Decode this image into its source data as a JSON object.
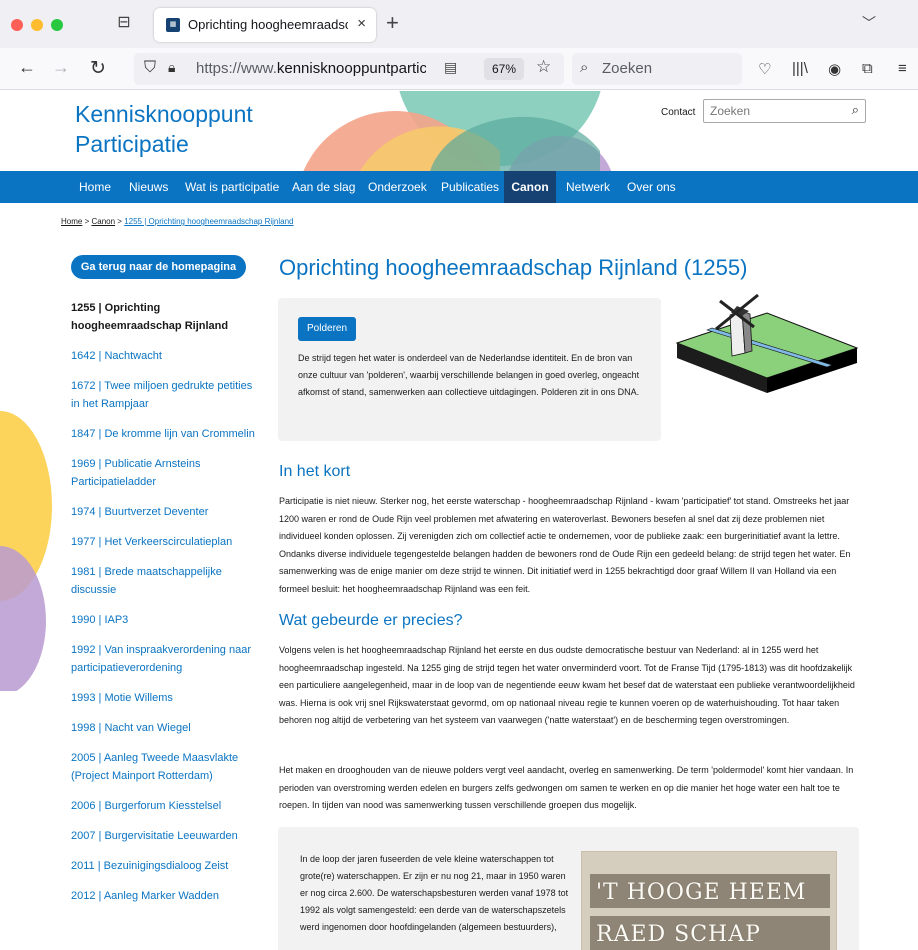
{
  "browser": {
    "tab_title": "Oprichting hoogheemraadschap",
    "tab_close": "×",
    "new_tab": "+",
    "url_prefix": "https://www.",
    "url_domain": "kennisknooppuntparticipati",
    "zoom": "67%",
    "search_placeholder": "Zoeken",
    "icons": [
      "tab-overview-icon",
      "back-arrow-icon",
      "forward-arrow-icon",
      "reload-icon",
      "shield-icon",
      "lock-icon",
      "reader-view-icon",
      "star-icon",
      "search-icon",
      "pocket-icon",
      "library-icon",
      "account-icon",
      "extensions-icon",
      "menu-icon"
    ]
  },
  "site": {
    "name_line1": "Kennisknooppunt",
    "name_line2": "Participatie",
    "contact": "Contact",
    "search_placeholder": "Zoeken",
    "colors": {
      "brand_blue": "#0b74c2",
      "nav_active": "#154273",
      "box_grey": "#f2f2f2"
    }
  },
  "nav": [
    {
      "label": "Home"
    },
    {
      "label": "Nieuws"
    },
    {
      "label": "Wat is participatie"
    },
    {
      "label": "Aan de slag"
    },
    {
      "label": "Onderzoek"
    },
    {
      "label": "Publicaties"
    },
    {
      "label": "Canon",
      "active": true
    },
    {
      "label": "Netwerk"
    },
    {
      "label": "Over ons"
    }
  ],
  "breadcrumb": {
    "home": "Home",
    "sep": ">",
    "canon": "Canon",
    "current": "1255 | Oprichting hoogheemraadschap Rijnland"
  },
  "sidebar": {
    "back_button": "Ga terug naar de homepagina",
    "items": [
      {
        "label": "1255 | Oprichting hoogheemraadschap Rijnland",
        "current": true
      },
      {
        "label": "1642 | Nachtwacht"
      },
      {
        "label": "1672 | Twee miljoen gedrukte petities in het Rampjaar"
      },
      {
        "label": "1847 | De kromme lijn van Crommelin"
      },
      {
        "label": "1969 | Publicatie Arnsteins Participatieladder"
      },
      {
        "label": "1974 | Buurtverzet Deventer"
      },
      {
        "label": "1977 | Het Verkeerscirculatieplan"
      },
      {
        "label": "1981 | Brede maatschappelijke discussie"
      },
      {
        "label": "1990 | IAP3"
      },
      {
        "label": "1992 | Van inspraakverordening naar participatieverordening"
      },
      {
        "label": "1993 | Motie Willems"
      },
      {
        "label": "1998 | Nacht van Wiegel"
      },
      {
        "label": "2005 | Aanleg Tweede Maasvlakte (Project Mainport Rotterdam)"
      },
      {
        "label": "2006 | Burgerforum Kiesstelsel"
      },
      {
        "label": "2007 | Burgervisitatie Leeuwarden"
      },
      {
        "label": "2011 | Bezuinigingsdialoog Zeist"
      },
      {
        "label": "2012 | Aanleg Marker Wadden"
      }
    ]
  },
  "main": {
    "title": "Oprichting hoogheemraadschap Rijnland (1255)",
    "intro": {
      "tag": "Polderen",
      "text": "De strijd tegen het water is onderdeel van de Nederlandse identiteit. En de bron van onze cultuur van 'polderen', waarbij verschillende belangen in goed overleg, ongeacht afkomst of stand, samenwerken aan collectieve uitdagingen. Polderen zit in ons DNA."
    },
    "kort": {
      "heading": "In het kort",
      "text": "Participatie is niet nieuw. Sterker nog, het eerste waterschap - hoogheemraadschap Rijnland - kwam 'participatief' tot stand. Omstreeks het jaar 1200 waren er rond de Oude Rijn veel problemen met afwatering en wateroverlast. Bewoners besefen al snel dat zij deze problemen niet individueel konden oplossen. Zij verenigden zich om collectief actie te ondernemen, voor de publieke zaak: een burgerinitiatief avant la lettre. Ondanks diverse individuele tegengestelde belangen hadden de bewoners rond de Oude Rijn een gedeeld belang: de strijd tegen het water. En samenwerking was de enige manier om deze strijd te winnen. Dit initiatief werd in 1255 bekrachtigd door graaf Willem II van Holland via een formeel besluit: het hoogheemraadschap Rijnland was een feit."
    },
    "precies": {
      "heading": "Wat gebeurde er precies?",
      "text1": "Volgens velen is het hoogheemraadschap Rijnland het eerste en dus oudste democratische bestuur van Nederland: al in 1255 werd het hoogheemraadschap ingesteld. Na 1255 ging de strijd tegen het water onverminderd voort. Tot de Franse Tijd (1795-1813) was dit hoofdzakelijk een particuliere aangelegenheid, maar in de loop van de negentiende eeuw kwam het besef dat de waterstaat een publieke verantwoordelijkheid was. Hierna is ook vrij snel Rijkswaterstaat gevormd, om op nationaal niveau regie te kunnen voeren op de waterhuishouding. Tot haar taken behoren nog altijd de verbetering van het systeem van vaarwegen ('natte waterstaat') en de bescherming tegen overstromingen.",
      "text2": "Het maken en drooghouden van de nieuwe polders vergt veel aandacht, overleg en samenwerking. De term 'poldermodel' komt hier vandaan. In perioden van overstroming werden edelen en burgers zelfs gedwongen om samen te werken en op die manier het hoge water een halt toe te roepen. In tijden van nood was samenwerking tussen verschillende groepen dus mogelijk."
    },
    "bottom": {
      "text": "In de loop der jaren fuseerden de vele kleine waterschappen tot grote(re) waterschappen. Er zijn er nu nog 21, maar in 1950 waren er nog circa 2.600. De waterschapsbesturen werden vanaf 1978 tot 1992 als volgt samengesteld: een derde van de waterschapszetels werd ingenomen door hoofdingelanden (algemeen bestuurders),",
      "image_line1": "'T HOOGE HEEM",
      "image_line2": "RAED    SCHAP"
    }
  }
}
